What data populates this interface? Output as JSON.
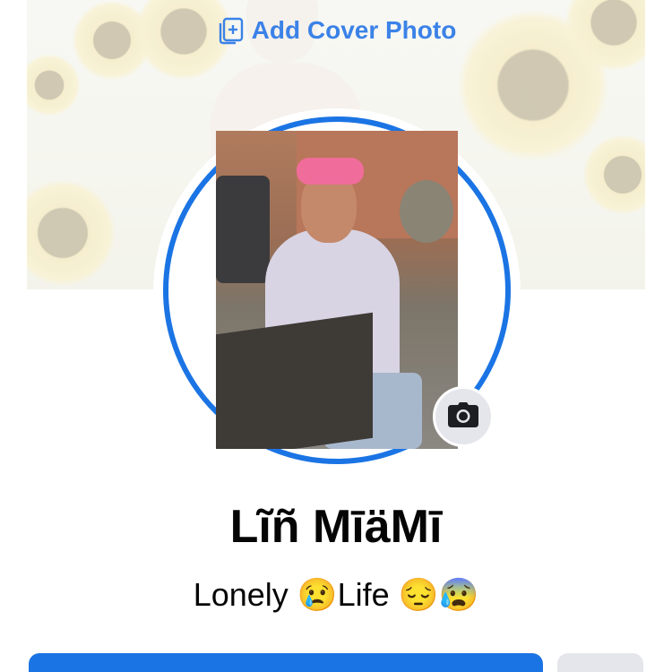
{
  "cover": {
    "add_cover_label": "Add Cover Photo",
    "icon": "add-photo-icon"
  },
  "profile": {
    "name": "Lĩñ MīäMī",
    "bio": "Lonely 😢Life 😔😰",
    "camera_icon": "camera-icon"
  },
  "colors": {
    "accent": "#1b74e4",
    "link": "#3b82e8",
    "secondary_button": "#e4e6eb",
    "text": "#050505"
  }
}
